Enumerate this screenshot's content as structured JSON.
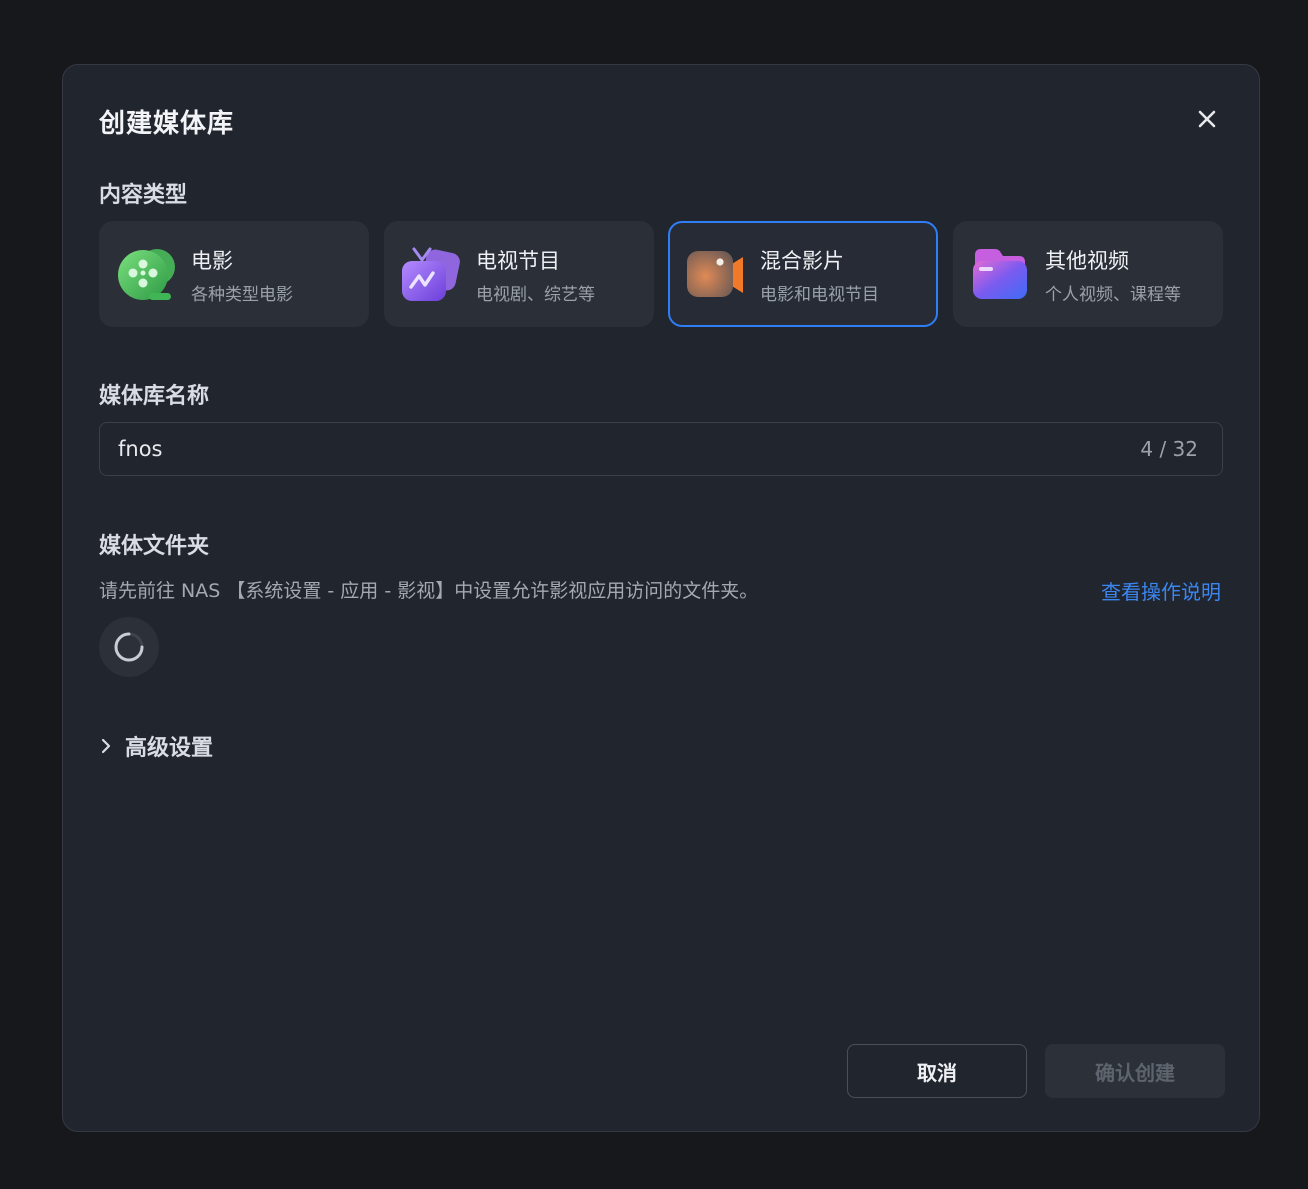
{
  "dialog": {
    "title": "创建媒体库",
    "close_icon": "close-icon"
  },
  "content_type": {
    "label": "内容类型",
    "options": [
      {
        "name": "电影",
        "desc": "各种类型电影",
        "icon": "film-reel-icon",
        "selected": false
      },
      {
        "name": "电视节目",
        "desc": "电视剧、综艺等",
        "icon": "tv-icon",
        "selected": false
      },
      {
        "name": "混合影片",
        "desc": "电影和电视节目",
        "icon": "video-camera-icon",
        "selected": true
      },
      {
        "name": "其他视频",
        "desc": "个人视频、课程等",
        "icon": "folder-icon",
        "selected": false
      }
    ]
  },
  "library_name": {
    "label": "媒体库名称",
    "value": "fnos",
    "counter": "4 / 32"
  },
  "media_folder": {
    "label": "媒体文件夹",
    "hint": "请先前往 NAS 【系统设置 - 应用 - 影视】中设置允许影视应用访问的文件夹。",
    "help_link": "查看操作说明",
    "loading_icon": "loading-spinner-icon"
  },
  "advanced": {
    "label": "高级设置",
    "icon": "chevron-right-icon"
  },
  "footer": {
    "cancel_label": "取消",
    "confirm_label": "确认创建"
  },
  "colors": {
    "accent": "#2f7ef5",
    "link": "#3b86f0",
    "dialog_bg": "#21252d",
    "page_bg": "#16181c"
  }
}
